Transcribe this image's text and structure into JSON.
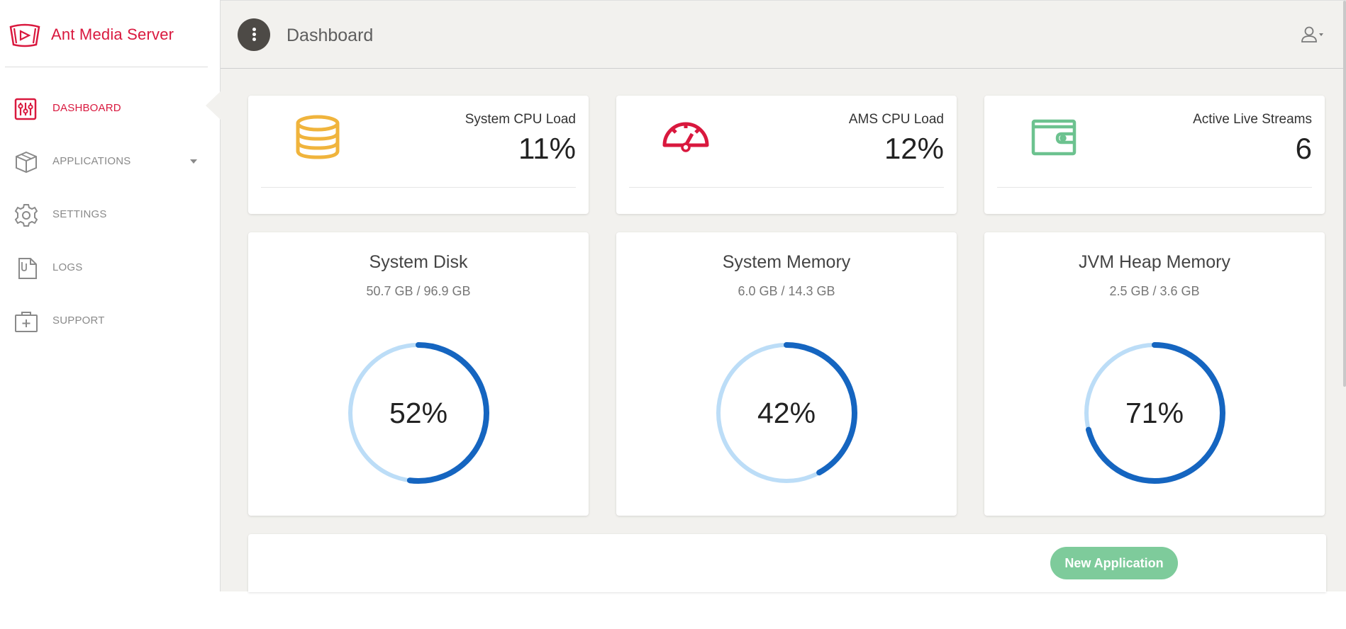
{
  "brand": {
    "name": "Ant Media Server",
    "color": "#d9183e"
  },
  "sidebar": {
    "items": [
      {
        "label": "DASHBOARD",
        "icon": "sliders-icon",
        "active": true
      },
      {
        "label": "APPLICATIONS",
        "icon": "box-icon",
        "has_caret": true
      },
      {
        "label": "SETTINGS",
        "icon": "gear-icon"
      },
      {
        "label": "LOGS",
        "icon": "document-icon"
      },
      {
        "label": "SUPPORT",
        "icon": "first-aid-icon"
      }
    ]
  },
  "header": {
    "title": "Dashboard",
    "user_icon": "user-icon"
  },
  "stats": [
    {
      "title": "System CPU Load",
      "value": "11%",
      "icon": "database-icon",
      "color": "#f0b43c"
    },
    {
      "title": "AMS CPU Load",
      "value": "12%",
      "icon": "speedometer-icon",
      "color": "#d9183e"
    },
    {
      "title": "Active Live Streams",
      "value": "6",
      "icon": "wallet-icon",
      "color": "#6cc28f"
    }
  ],
  "gauges": [
    {
      "title": "System Disk",
      "subtitle": "50.7 GB / 96.9 GB",
      "percent_label": "52%",
      "fraction": 0.52
    },
    {
      "title": "System Memory",
      "subtitle": "6.0 GB / 14.3 GB",
      "percent_label": "42%",
      "fraction": 0.42
    },
    {
      "title": "JVM Heap Memory",
      "subtitle": "2.5 GB / 3.6 GB",
      "percent_label": "71%",
      "fraction": 0.71
    }
  ],
  "gauge_colors": {
    "track": "#bcddf7",
    "fill": "#1565c0"
  },
  "actions": {
    "new_application": "New Application",
    "button_color": "#7ecb9b"
  }
}
